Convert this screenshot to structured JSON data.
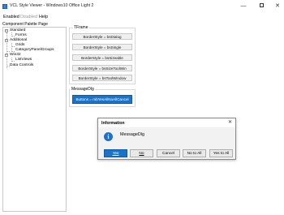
{
  "window": {
    "title": "VCL Style Viewer - Windows10 Office Light 2",
    "minimize_glyph": "—",
    "close_glyph": "✕"
  },
  "menu": {
    "enabled": "Enabled",
    "disabled": "Disabled",
    "help": "Help"
  },
  "palette": {
    "caption": "Component Palette Page",
    "tree": [
      {
        "label": "Standard",
        "expand": "−"
      },
      {
        "label": "Forms"
      },
      {
        "label": "Additional",
        "expand": "−"
      },
      {
        "label": "Grids"
      },
      {
        "label": "CategoryPanelGroups"
      },
      {
        "label": "Win32",
        "expand": "−"
      },
      {
        "label": "ListViews"
      },
      {
        "label": "Data Controls"
      }
    ]
  },
  "tframe": {
    "caption": "TFrame",
    "buttons": [
      "BorderStyle = bsDialog",
      "BorderStyle = bsSingle",
      "BorderStyle = bsSizeable",
      "BorderStyle = bsSizeToolWin",
      "BorderStyle = bsToolWindow"
    ]
  },
  "msgdlg": {
    "caption": "MessageDlg",
    "button": "Buttons = mbYesAllNoAllCancel"
  },
  "dialog": {
    "title": "Information",
    "icon_glyph": "i",
    "message": "MessageDlg",
    "close_glyph": "✕",
    "buttons": {
      "yes": "Yes",
      "no": "No",
      "cancel": "Cancel",
      "no_to_all": "No to All",
      "yes_to_all": "Yes to All"
    }
  },
  "colors": {
    "accent": "#1a73c8",
    "info_icon": "#1f6fcc"
  }
}
